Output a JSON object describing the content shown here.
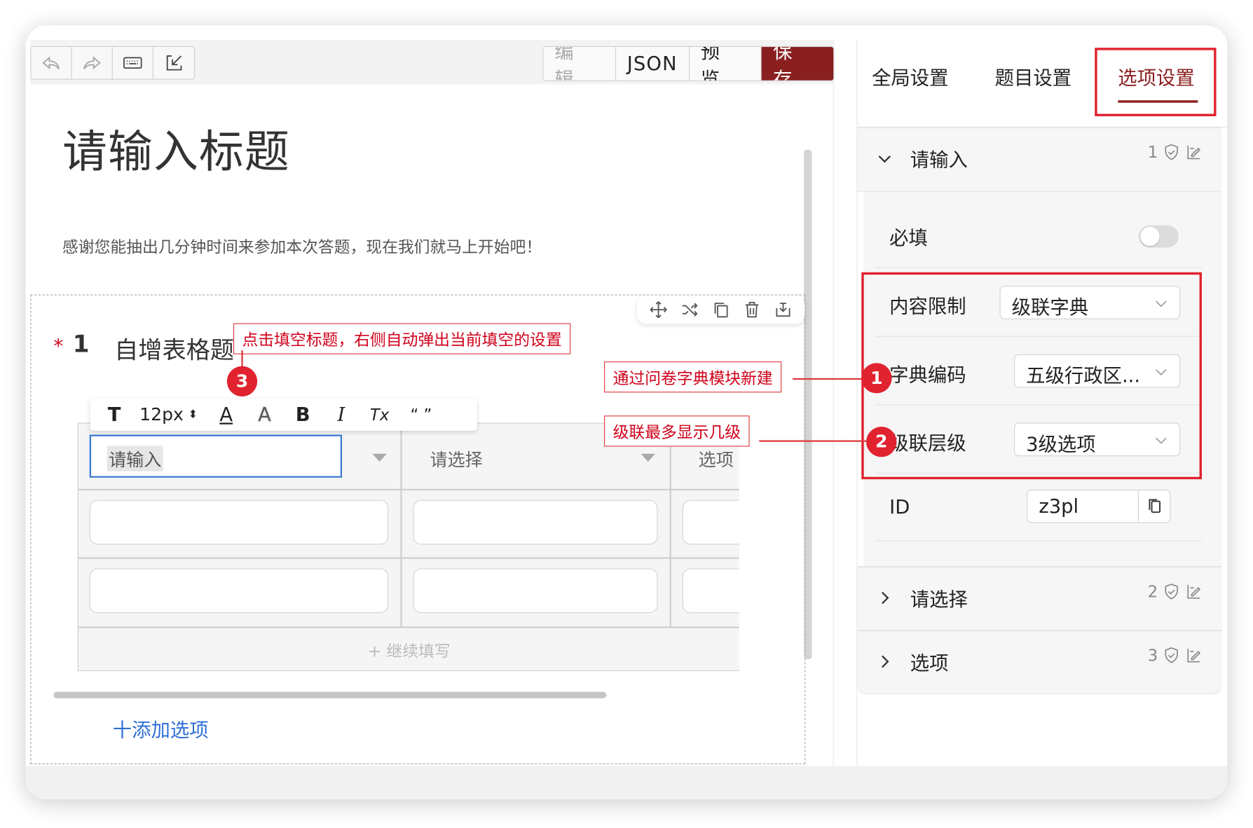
{
  "toolbar": {
    "icons": [
      "undo-icon",
      "redo-icon",
      "keyboard-icon",
      "import-icon"
    ],
    "modes": [
      "编 辑",
      "JSON",
      "预 览",
      "保 存"
    ]
  },
  "survey": {
    "title": "请输入标题",
    "description": "感谢您能抽出几分钟时间来参加本次答题，现在我们就马上开始吧！"
  },
  "question": {
    "required_mark": "*",
    "number": "1",
    "title": "自增表格题",
    "format_bar": {
      "text_icon": "T",
      "font_size": "12px",
      "items": [
        "A",
        "A",
        "B",
        "I",
        "Tx",
        "“ ”"
      ]
    },
    "columns": [
      "请输入",
      "请选择",
      "选项"
    ],
    "add_row_label": "+ 继续填写",
    "add_option_label": "十添加选项"
  },
  "annotations": {
    "a3": "点击填空标题，右侧自动弹出当前填空的设置",
    "a1": "通过问卷字典模块新建",
    "a2": "级联最多显示几级",
    "badge1": "1",
    "badge2": "2",
    "badge3": "3"
  },
  "panel": {
    "tabs": [
      "全局设置",
      "题目设置",
      "选项设置"
    ],
    "active_tab": "选项设置",
    "sections": [
      {
        "title": "请输入",
        "index": "1",
        "expanded": true,
        "fields": {
          "required_label": "必填",
          "required_on": false,
          "content_limit_label": "内容限制",
          "content_limit_value": "级联字典",
          "dict_code_label": "字典编码",
          "dict_code_value": "五级行政区...",
          "cascade_level_label": "级联层级",
          "cascade_level_value": "3级选项",
          "id_label": "ID",
          "id_value": "z3pl"
        }
      },
      {
        "title": "请选择",
        "index": "2",
        "expanded": false
      },
      {
        "title": "选项",
        "index": "3",
        "expanded": false
      }
    ]
  },
  "colors": {
    "save_button": "#8a1f1f",
    "annotation_red": "#e0232f",
    "link_blue": "#2e6fd6",
    "input_focus": "#3a7bd5"
  }
}
